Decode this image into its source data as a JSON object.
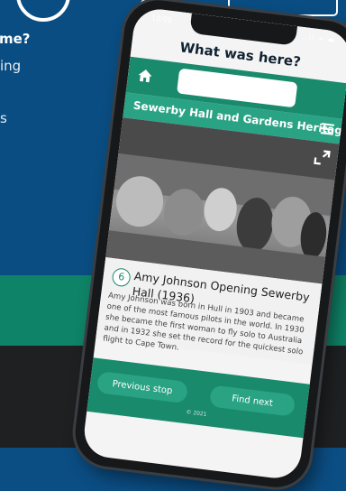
{
  "promo": {
    "line1": "me?",
    "line2": "ing",
    "line3": "s"
  },
  "phone": {
    "status": {
      "time": "10:05",
      "icons": "..ıl ≈ ▬"
    },
    "app_title": "What was here?",
    "search": {
      "value": ""
    },
    "site_title": "Sewerby Hall and Gardens Heritage",
    "stop": {
      "number": "6",
      "title": "Amy Johnson Opening Sewerby Hall (1936)",
      "description": "Amy Johnson was born in Hull in 1903 and became one of the most famous pilots in the world. In 1930 she became the first woman to fly solo to Australia and in 1932 she set the record for the quickest solo flight to Cape Town."
    },
    "buttons": {
      "previous": "Previous stop",
      "next": "Find next"
    },
    "copyright": "© 2021"
  },
  "colors": {
    "page_blue": "#0a4d82",
    "band_green": "#0f8367",
    "app_green": "#1a8a6c",
    "app_green_light": "#2aa385"
  }
}
